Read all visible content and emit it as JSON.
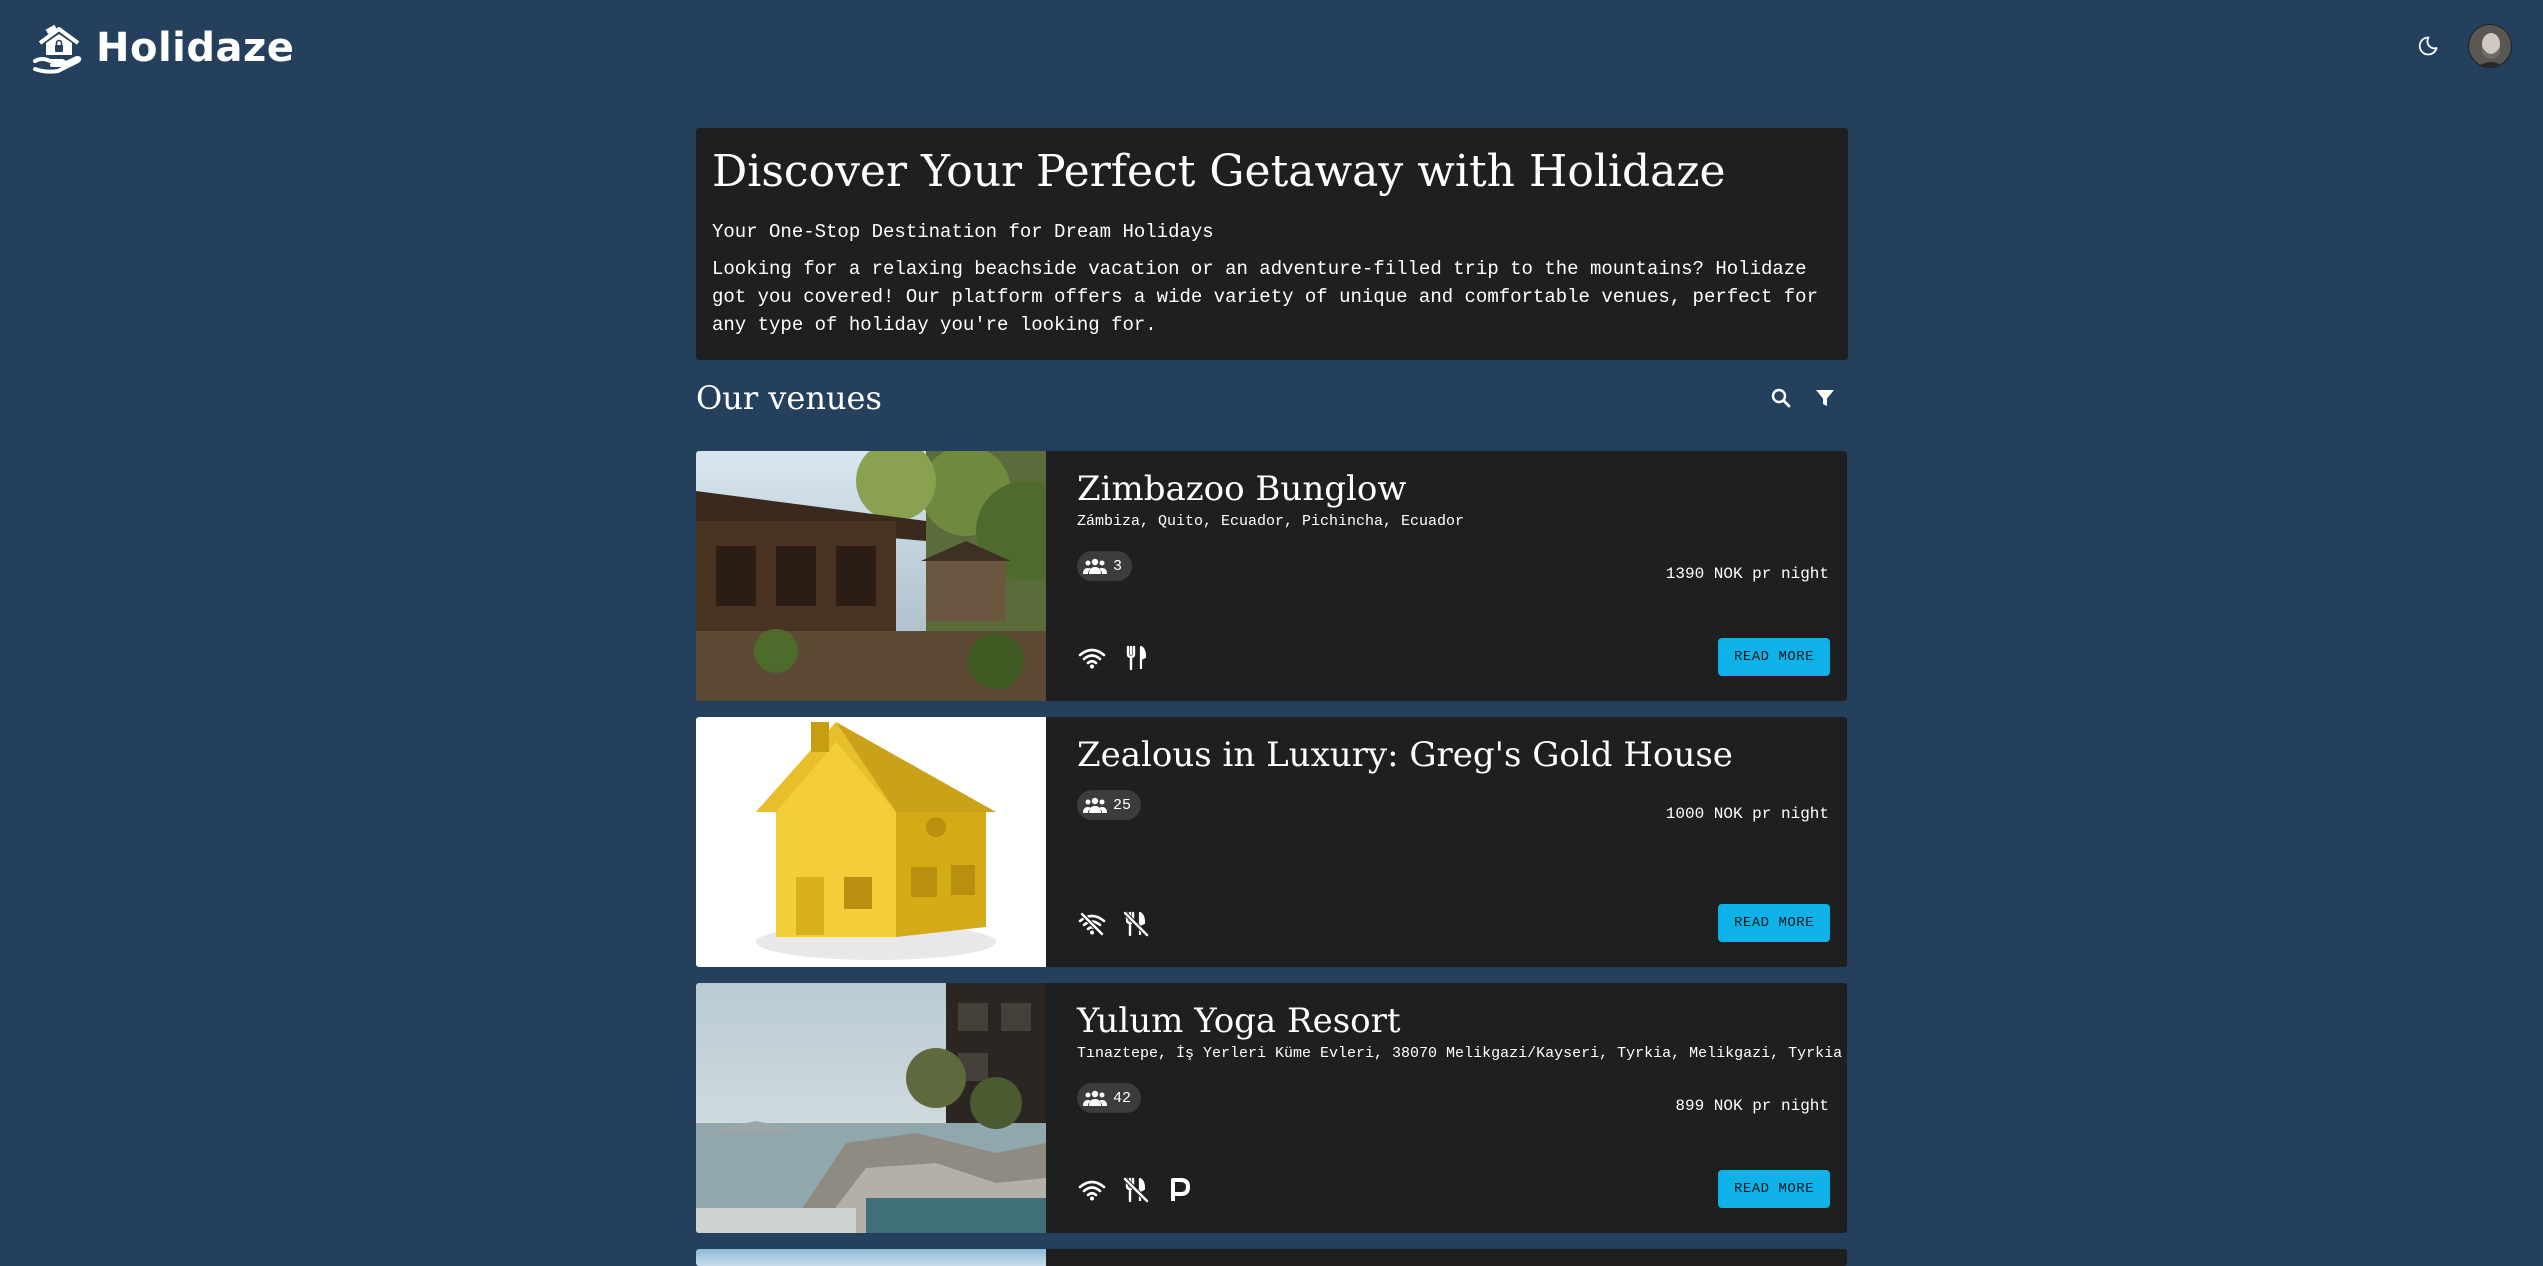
{
  "header": {
    "brand": "Holidaze",
    "theme_icon": "moon-icon",
    "avatar_icon": "user-avatar"
  },
  "hero": {
    "title": "Discover Your Perfect Getaway with Holidaze",
    "subtitle": "Your One-Stop Destination for Dream Holidays",
    "text": "Looking for a relaxing beachside vacation or an adventure-filled trip to the mountains? Holidaze got you covered! Our platform offers a wide variety of unique and comfortable venues, perfect for any type of holiday you're looking for."
  },
  "venues_section": {
    "title": "Our venues",
    "search_icon": "search-icon",
    "filter_icon": "filter-icon"
  },
  "colors": {
    "background": "#25405c",
    "card": "#1f1f1f",
    "accent": "#0fb2e8"
  },
  "venues": [
    {
      "name": "Zimbazoo Bunglow",
      "address": "Zámbiza, Quito, Ecuador, Pichincha, Ecuador",
      "guests": "3",
      "price": "1390 NOK pr night",
      "amenities": [
        "wifi-icon",
        "restaurant-icon"
      ],
      "button": "READ MORE"
    },
    {
      "name": "Zealous in Luxury: Greg's Gold House",
      "address": "",
      "guests": "25",
      "price": "1000 NOK pr night",
      "amenities": [
        "wifi-off-icon",
        "no-food-icon"
      ],
      "button": "READ MORE"
    },
    {
      "name": "Yulum Yoga Resort",
      "address": "Tınaztepe, İş Yerleri Küme Evleri, 38070 Melikgazi/Kayseri, Tyrkia, Melikgazi, Tyrkia",
      "guests": "42",
      "price": "899 NOK pr night",
      "amenities": [
        "wifi-icon",
        "no-food-icon",
        "parking-icon"
      ],
      "button": "READ MORE"
    }
  ]
}
